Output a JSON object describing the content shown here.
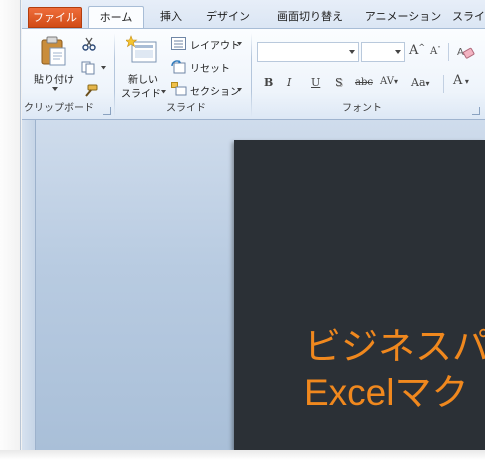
{
  "tabs": {
    "file": "ファイル",
    "home": "ホーム",
    "insert": "挿入",
    "design": "デザイン",
    "transitions": "画面切り替え",
    "animations": "アニメーション",
    "slideshow": "スライ"
  },
  "clipboard": {
    "paste_label": "貼り付け",
    "group_label": "クリップボード"
  },
  "slides": {
    "new_slide_line1": "新しい",
    "new_slide_line2": "スライド",
    "layout_label": "レイアウト",
    "reset_label": "リセット",
    "section_label": "セクション",
    "group_label": "スライド"
  },
  "font": {
    "font_name_value": "",
    "font_size_value": "",
    "bold": "B",
    "italic": "I",
    "underline": "U",
    "shadow": "S",
    "strike": "abc",
    "spacing": "AV",
    "case": "Aa",
    "color": "A",
    "grow": "A",
    "shrink": "A",
    "group_label": "フォント"
  },
  "slide_content": {
    "line1": "ビジネスパ",
    "line2": "Excelマク"
  },
  "colors": {
    "file_tab": "#d9541e",
    "slide_bg": "#2b3036",
    "slide_text": "#f0881e"
  }
}
